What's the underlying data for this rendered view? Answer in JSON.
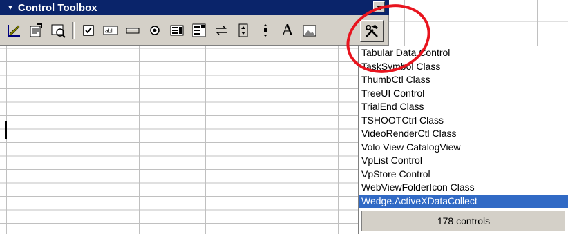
{
  "toolbox": {
    "title": "Control Toolbox",
    "close_label": "x",
    "tools": [
      {
        "icon": "design-mode-icon"
      },
      {
        "icon": "properties-icon"
      },
      {
        "icon": "view-code-icon"
      },
      {
        "icon": "checkbox-tool-icon"
      },
      {
        "icon": "textbox-tool-icon"
      },
      {
        "icon": "command-button-tool-icon"
      },
      {
        "icon": "option-button-tool-icon"
      },
      {
        "icon": "listbox-tool-icon"
      },
      {
        "icon": "combobox-tool-icon"
      },
      {
        "icon": "toggle-button-tool-icon"
      },
      {
        "icon": "spin-button-tool-icon"
      },
      {
        "icon": "scrollbar-tool-icon"
      },
      {
        "icon": "label-tool-icon"
      },
      {
        "icon": "image-tool-icon"
      }
    ],
    "label_tool_text": "A",
    "more_controls_icon": "hammer-wrench-icon"
  },
  "controls_list": {
    "items": [
      "Tabular Data Control",
      "TaskSymbol Class",
      "ThumbCtl Class",
      "TreeUI Control",
      "TrialEnd Class",
      "TSHOOTCtrl Class",
      "VideoRenderCtl Class",
      "Volo View CatalogView",
      "VpList Control",
      "VpStore Control",
      "WebViewFolderIcon Class",
      "Wedge.ActiveXDataCollect"
    ],
    "selected": "Wedge.ActiveXDataCollect",
    "status": "178 controls"
  },
  "colors": {
    "titlebar": "#0a246a",
    "selection": "#316ac5",
    "highlight_ring": "#e8141e"
  }
}
